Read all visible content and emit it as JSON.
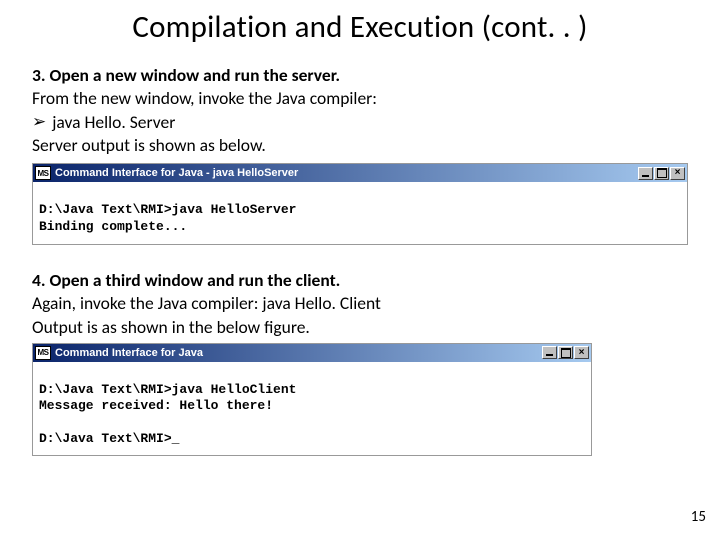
{
  "title": "Compilation and Execution (cont. . )",
  "step3": {
    "heading": "3. Open a new window and run the server.",
    "line1": "From the new window, invoke the Java compiler:",
    "bullet": "java Hello. Server",
    "line2": "Server output is shown as below."
  },
  "console1": {
    "icon_label": "MS",
    "title": "Command Interface for Java - java HelloServer",
    "output": "\nD:\\Java Text\\RMI>java HelloServer\nBinding complete..."
  },
  "step4": {
    "heading": "4. Open a third window and run the client.",
    "line1": "Again, invoke the Java compiler:    java Hello. Client",
    "line2": "Output is as shown in the below figure."
  },
  "console2a": {
    "icon_label": "MS",
    "title": "Command Interface for Java",
    "output": "\nD:\\Java Text\\RMI>java HelloClient\nMessage received: Hello there!\n\nD:\\Java Text\\RMI>_"
  },
  "page_number": "15"
}
